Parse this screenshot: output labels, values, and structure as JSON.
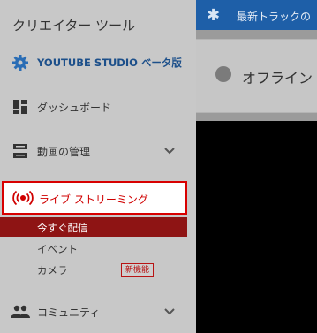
{
  "sidebar": {
    "title": "クリエイター ツール",
    "studio_label": "YOUTUBE STUDIO ベータ版",
    "dashboard_label": "ダッシュボード",
    "video_manager_label": "動画の管理",
    "live_label": "ライブ ストリーミング",
    "sub_items": {
      "stream_now": "今すぐ配信",
      "events": "イベント",
      "camera": "カメラ",
      "camera_badge": "新機能"
    },
    "community_label": "コミュニティ"
  },
  "banner": {
    "text": "最新トラックの"
  },
  "status_card": {
    "text": "オフライン"
  },
  "colors": {
    "accent_red": "#d80000",
    "active_bg": "#8e1414",
    "banner_blue": "#1e5fa8",
    "studio_blue": "#1c4f8a"
  }
}
